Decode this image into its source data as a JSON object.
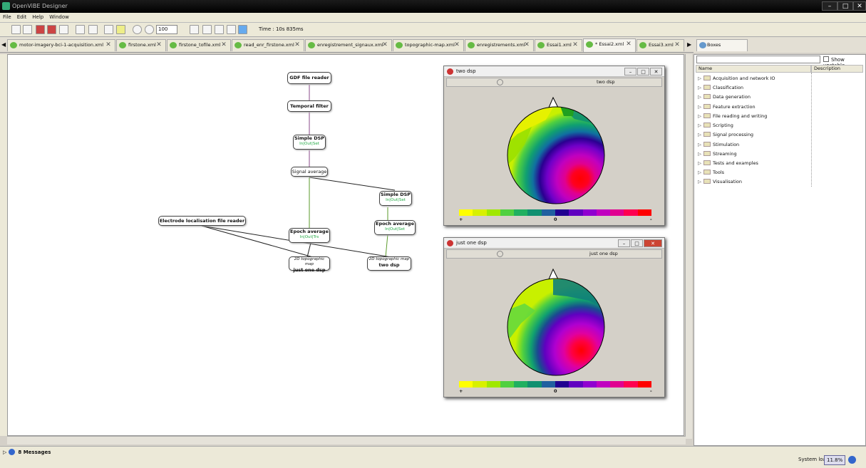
{
  "app": {
    "title": "OpenViBE Designer"
  },
  "menu": [
    "File",
    "Edit",
    "Help",
    "Window"
  ],
  "toolbar": {
    "zoom": "100",
    "time": "Time : 10s 835ms"
  },
  "tabs": [
    {
      "label": "motor-imagery-bci-1-acquisition.xml"
    },
    {
      "label": "firstone.xml"
    },
    {
      "label": "firstone_tofile.xml"
    },
    {
      "label": "read_enr_firstone.xml"
    },
    {
      "label": "enregistrement_signaux.xml"
    },
    {
      "label": "topographic-map.xml"
    },
    {
      "label": "enregistrements.xml"
    },
    {
      "label": "Essai1.xml"
    },
    {
      "label": "* Essai2.xml"
    },
    {
      "label": "Essai3.xml"
    }
  ],
  "right_tab": {
    "label": "Boxes"
  },
  "boxes_panel": {
    "show_unstable": "Show unstable",
    "col_name": "Name",
    "col_description": "Description",
    "categories": [
      "Acquisition and network IO",
      "Classification",
      "Data generation",
      "Feature extraction",
      "File reading and writing",
      "Scripting",
      "Signal processing",
      "Stimulation",
      "Streaming",
      "Tests and examples",
      "Tools",
      "Visualisation"
    ]
  },
  "nodes": {
    "gdf": "GDF file reader",
    "temporal": "Temporal filter",
    "dsp1": "Simple DSP",
    "dsp1_io": "In|Out|Set",
    "sigavg": "Signal average",
    "dsp2": "Simple DSP",
    "dsp2_io": "In|Out|Set",
    "epoch1": "Epoch average",
    "epoch1_io": "In|Out|Trs",
    "epoch2": "Epoch average",
    "epoch2_io": "In|Out|Set",
    "electrode": "Electrode localisation file reader",
    "map1_type": "2D topographic map",
    "map1": "just one dsp",
    "map2_type": "2D topographic map",
    "map2": "two dsp"
  },
  "windows": {
    "two_dsp": {
      "title": "two dsp",
      "sub": "two dsp",
      "plus": "+",
      "zero": "0",
      "minus": "-"
    },
    "just_one": {
      "title": "just one dsp",
      "sub": "just one dsp",
      "plus": "+",
      "zero": "0",
      "minus": "-"
    }
  },
  "legend_colors": [
    "#ffff00",
    "#d8f000",
    "#a0e800",
    "#50d040",
    "#20b060",
    "#109070",
    "#2060a0",
    "#200090",
    "#6000c0",
    "#9000d0",
    "#c000c0",
    "#e00090",
    "#ff0050",
    "#ff0000"
  ],
  "status": {
    "messages": "8 Messages",
    "system_load_label": "System load :",
    "system_load": "11.8%"
  }
}
